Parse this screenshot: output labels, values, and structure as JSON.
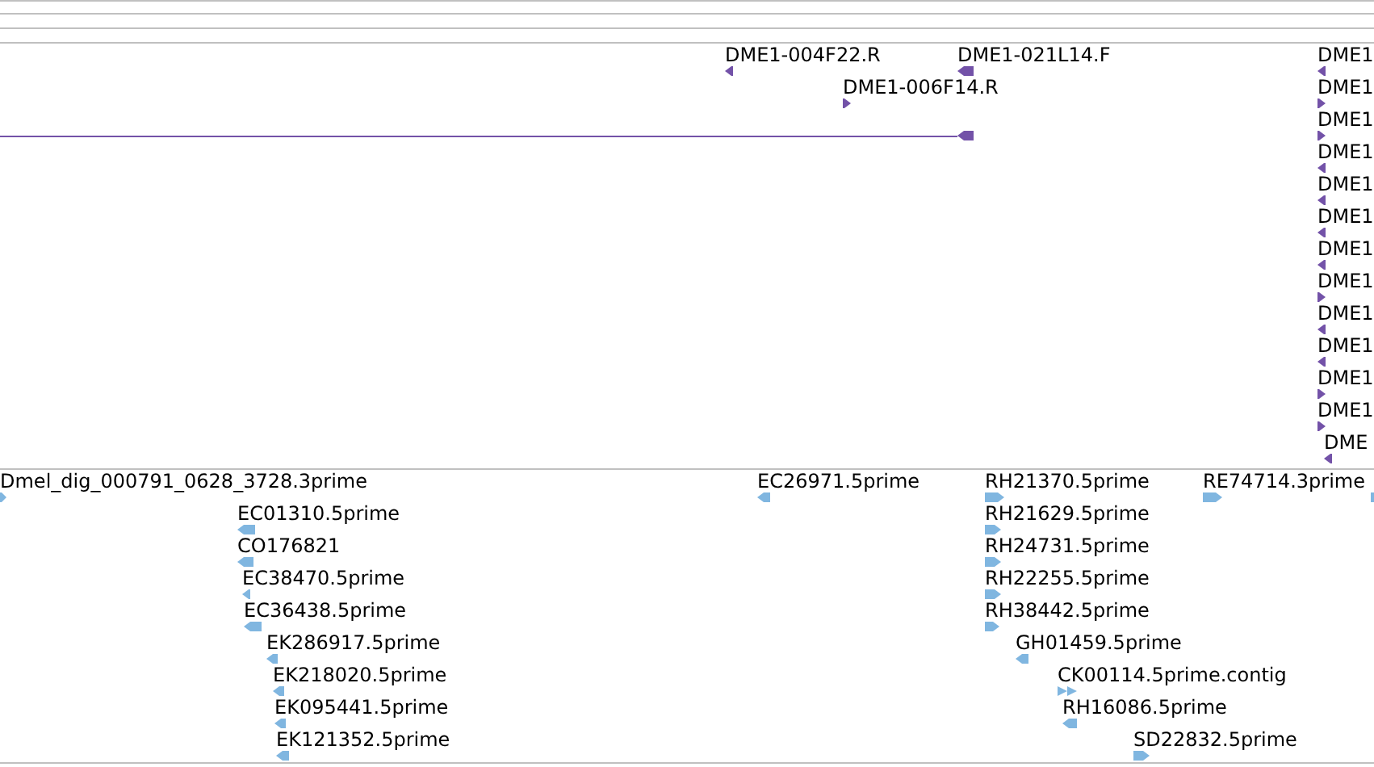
{
  "tracks": [
    {
      "features": [
        {
          "label": "DME1-004F22.R",
          "reverse": true
        },
        {
          "label": "DME1-021L14.F",
          "reverse": true
        },
        {
          "label": "DME1-006F14.R",
          "reverse": false
        },
        {
          "reverse": true
        },
        {
          "label": "DME1",
          "reverse": true
        },
        {
          "label": "DME1",
          "reverse": false
        },
        {
          "label": "DME1",
          "reverse": false
        },
        {
          "label": "DME1",
          "reverse": true
        },
        {
          "label": "DME1",
          "reverse": true
        },
        {
          "label": "DME1",
          "reverse": true
        },
        {
          "label": "DME1",
          "reverse": true
        },
        {
          "label": "DME1",
          "reverse": false
        },
        {
          "label": "DME1",
          "reverse": true
        },
        {
          "label": "DME1",
          "reverse": true
        },
        {
          "label": "DME1",
          "reverse": false
        },
        {
          "label": "DME1",
          "reverse": false
        },
        {
          "label": "DME",
          "reverse": true
        }
      ]
    },
    {
      "features": [
        {
          "label": "Dmel_dig_000791_0628_3728.3prime",
          "reverse": false
        },
        {
          "label": "EC01310.5prime",
          "reverse": true
        },
        {
          "label": "CO176821",
          "reverse": true
        },
        {
          "label": "EC38470.5prime",
          "reverse": true
        },
        {
          "label": "EC36438.5prime",
          "reverse": true
        },
        {
          "label": "EK286917.5prime",
          "reverse": true
        },
        {
          "label": "EK218020.5prime",
          "reverse": true
        },
        {
          "label": "EK095441.5prime",
          "reverse": true
        },
        {
          "label": "EK121352.5prime",
          "reverse": true
        },
        {
          "label": "EC26971.5prime",
          "reverse": true
        },
        {
          "label": "RH21370.5prime",
          "reverse": false
        },
        {
          "label": "RH21629.5prime",
          "reverse": false
        },
        {
          "label": "RH24731.5prime",
          "reverse": false
        },
        {
          "label": "RH22255.5prime",
          "reverse": false
        },
        {
          "label": "RH38442.5prime",
          "reverse": false
        },
        {
          "label": "GH01459.5prime",
          "reverse": true
        },
        {
          "label": "CK00114.5prime.contig",
          "reverse": false
        },
        {
          "label": "RH16086.5prime",
          "reverse": true
        },
        {
          "label": "SD22832.5prime",
          "reverse": false
        },
        {
          "label": "RE74714.3prime",
          "reverse": false
        },
        {
          "reverse": false
        }
      ]
    }
  ]
}
